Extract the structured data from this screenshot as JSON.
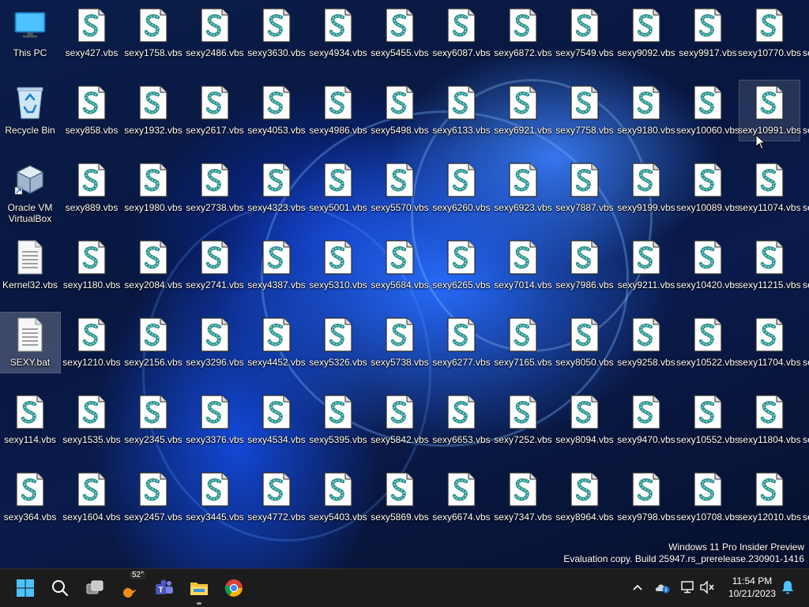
{
  "desktop": {
    "columns": [
      [
        "This PC",
        "Recycle Bin",
        "Oracle VM VirtualBox",
        "Kernel32.vbs",
        "SEXY.bat",
        "sexy114.vbs",
        "sexy364.vbs"
      ],
      [
        "sexy427.vbs",
        "sexy858.vbs",
        "sexy889.vbs",
        "sexy1180.vbs",
        "sexy1210.vbs",
        "sexy1535.vbs",
        "sexy1604.vbs"
      ],
      [
        "sexy1758.vbs",
        "sexy1932.vbs",
        "sexy1980.vbs",
        "sexy2084.vbs",
        "sexy2156.vbs",
        "sexy2345.vbs",
        "sexy2457.vbs"
      ],
      [
        "sexy2486.vbs",
        "sexy2617.vbs",
        "sexy2738.vbs",
        "sexy2741.vbs",
        "sexy3296.vbs",
        "sexy3376.vbs",
        "sexy3445.vbs"
      ],
      [
        "sexy3630.vbs",
        "sexy4053.vbs",
        "sexy4323.vbs",
        "sexy4387.vbs",
        "sexy4452.vbs",
        "sexy4534.vbs",
        "sexy4772.vbs"
      ],
      [
        "sexy4934.vbs",
        "sexy4986.vbs",
        "sexy5001.vbs",
        "sexy5310.vbs",
        "sexy5326.vbs",
        "sexy5395.vbs",
        "sexy5403.vbs"
      ],
      [
        "sexy5455.vbs",
        "sexy5498.vbs",
        "sexy5570.vbs",
        "sexy5684.vbs",
        "sexy5738.vbs",
        "sexy5842.vbs",
        "sexy5869.vbs"
      ],
      [
        "sexy6087.vbs",
        "sexy6133.vbs",
        "sexy6260.vbs",
        "sexy6265.vbs",
        "sexy6277.vbs",
        "sexy6653.vbs",
        "sexy6674.vbs"
      ],
      [
        "sexy6872.vbs",
        "sexy6921.vbs",
        "sexy6923.vbs",
        "sexy7014.vbs",
        "sexy7165.vbs",
        "sexy7252.vbs",
        "sexy7347.vbs"
      ],
      [
        "sexy7549.vbs",
        "sexy7758.vbs",
        "sexy7887.vbs",
        "sexy7986.vbs",
        "sexy8050.vbs",
        "sexy8094.vbs",
        "sexy8964.vbs"
      ],
      [
        "sexy9092.vbs",
        "sexy9180.vbs",
        "sexy9199.vbs",
        "sexy9211.vbs",
        "sexy9258.vbs",
        "sexy9470.vbs",
        "sexy9798.vbs"
      ],
      [
        "sexy9917.vbs",
        "sexy10060.vbs",
        "sexy10089.vbs",
        "sexy10420.vbs",
        "sexy10522.vbs",
        "sexy10552.vbs",
        "sexy10708.vbs"
      ],
      [
        "sexy10770.vbs",
        "sexy10991.vbs",
        "sexy11074.vbs",
        "sexy11215.vbs",
        "sexy11704.vbs",
        "sexy11804.vbs",
        "sexy12010.vbs"
      ]
    ],
    "partial_column_label": "se",
    "selected_icon": "SEXY.bat",
    "hovered_icon": "sexy10991.vbs"
  },
  "watermark": {
    "line1": "Windows 11 Pro Insider Preview",
    "line2": "Evaluation copy. Build 25947.rs_prerelease.230901-1416"
  },
  "taskbar": {
    "weather_temp": "52°",
    "clock_time": "11:54 PM",
    "clock_date": "10/21/2023"
  },
  "colors": {
    "accent": "#0078d4",
    "taskbar_bg": "#1c1c1c"
  }
}
